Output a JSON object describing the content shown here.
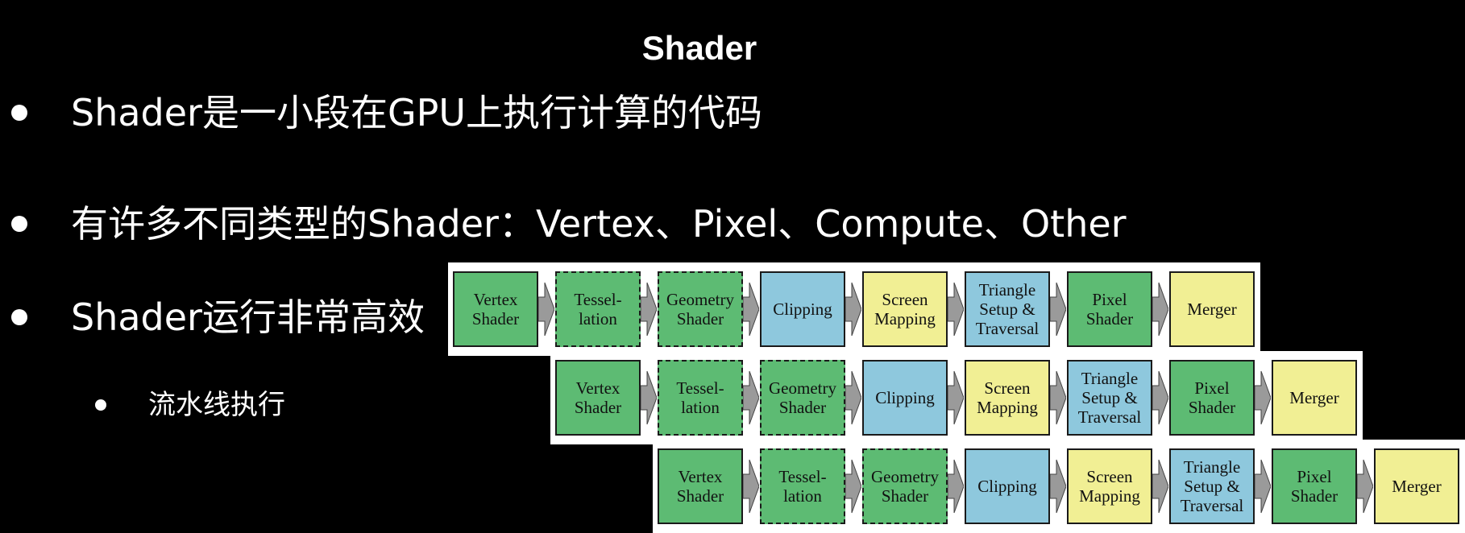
{
  "title": "Shader",
  "bullets": [
    {
      "text": "Shader是一小段在GPU上执行计算的代码"
    },
    {
      "text": "有许多不同类型的Shader：Vertex、Pixel、Compute、Other"
    },
    {
      "text": "Shader运行非常高效"
    }
  ],
  "sub_bullets": [
    {
      "text": "流水线执行"
    }
  ],
  "pipeline": {
    "stages": [
      {
        "label": "Vertex\nShader",
        "color": "#5dbb73",
        "dashed": false,
        "icon": "vertex-shader"
      },
      {
        "label": "Tessel-\nlation",
        "color": "#5dbb73",
        "dashed": true,
        "icon": "tessellation"
      },
      {
        "label": "Geometry\nShader",
        "color": "#5dbb73",
        "dashed": true,
        "icon": "geometry-shader"
      },
      {
        "label": "Clipping",
        "color": "#8ec8dd",
        "dashed": false,
        "icon": "clipping"
      },
      {
        "label": "Screen\nMapping",
        "color": "#f1ef94",
        "dashed": false,
        "icon": "screen-mapping"
      },
      {
        "label": "Triangle\nSetup &\nTraversal",
        "color": "#8ec8dd",
        "dashed": false,
        "icon": "triangle-setup"
      },
      {
        "label": "Pixel\nShader",
        "color": "#5dbb73",
        "dashed": false,
        "icon": "pixel-shader"
      },
      {
        "label": "Merger",
        "color": "#f1ef94",
        "dashed": false,
        "icon": "merger"
      }
    ],
    "rows": 3,
    "arrow_color": "#9a9a9a"
  }
}
